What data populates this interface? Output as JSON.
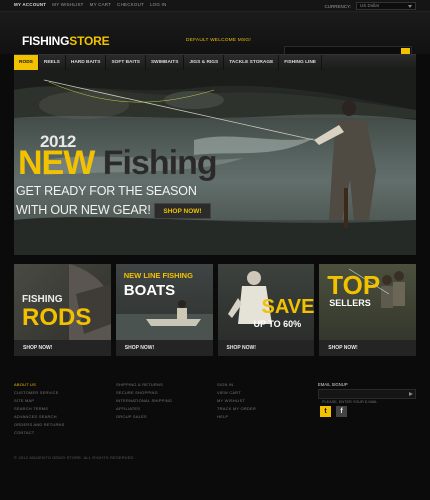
{
  "top_links": [
    "My Account",
    "My Wishlist",
    "My Cart",
    "Checkout",
    "Log In"
  ],
  "currency": {
    "label": "Currency:",
    "value": "US Dollar"
  },
  "logo": {
    "part1": "FISHING",
    "part2": "STORE"
  },
  "welcome": "Default welcome msg!",
  "search": {
    "value": "",
    "placeholder": ""
  },
  "nav": [
    "Rods",
    "Reels",
    "Hard Baits",
    "Soft Baits",
    "Swimbaits",
    "Jigs & Rigs",
    "Tackle Storage",
    "Fishing Line"
  ],
  "hero": {
    "year": "2012",
    "word1": "NEW",
    "word2": "Fishing",
    "line1": "Get ready for the season",
    "line2": "with our new gear!",
    "cta": "Shop now!"
  },
  "banners": [
    {
      "small": "Fishing",
      "big": "Rods",
      "cta": "Shop now!"
    },
    {
      "small": "New line fishing",
      "big": "Boats",
      "cta": "Shop now!"
    },
    {
      "big": "Save",
      "small": "Up to 60%",
      "cta": "Shop now!"
    },
    {
      "big": "Top",
      "small": "Sellers",
      "cta": "Shop now!"
    }
  ],
  "footer": {
    "col1": [
      "About Us",
      "Customer Service",
      "Site Map",
      "Search Terms",
      "Advanced Search",
      "Orders and Returns",
      "Contact"
    ],
    "col2": [
      "Shipping & Returns",
      "Secure Shopping",
      "International Shipping",
      "Affiliates",
      "Group Sales"
    ],
    "col3": [
      "Sign In",
      "View Cart",
      "My Wishlist",
      "Track My Order",
      "Help"
    ],
    "email_label": "Email signup",
    "email_placeholder": "Please, enter your e-mail",
    "copyright": "© 2012 Magento Demo Store. All Rights Reserved."
  },
  "colors": {
    "accent": "#f2c100",
    "bg": "#0b0b0b"
  },
  "icons": {
    "search": "search-icon",
    "twitter": "twitter-icon",
    "facebook": "facebook-icon"
  }
}
